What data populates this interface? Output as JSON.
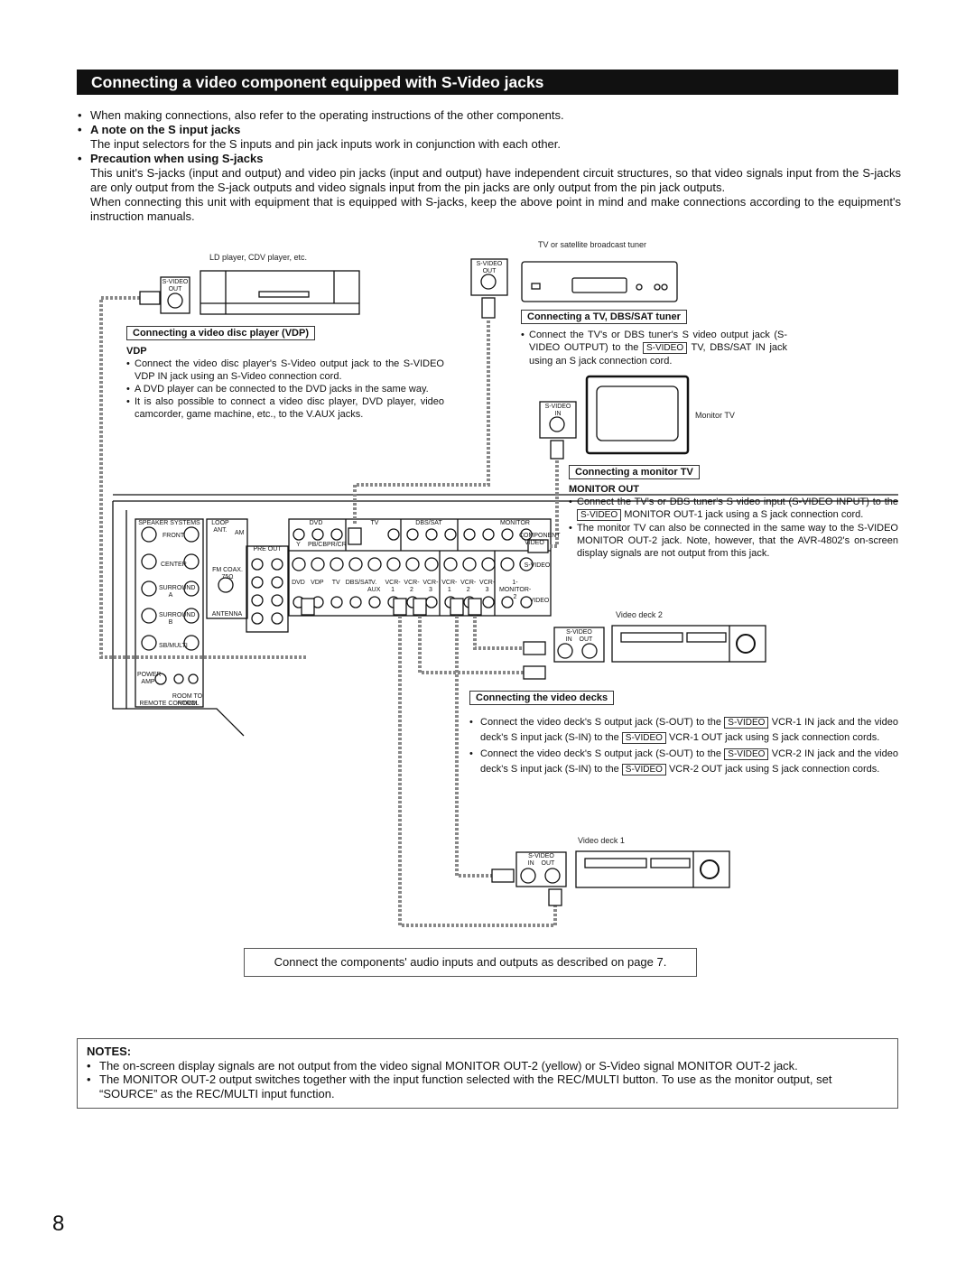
{
  "title": "Connecting a video component equipped with S-Video jacks",
  "intro": {
    "bullet1": "When making connections, also refer to the operating instructions of the other components.",
    "note_heading": "A note on the S input jacks",
    "note_text": "The input selectors for the S inputs and pin jack inputs work in conjunction with each other.",
    "precaution_heading": "Precaution when using S-jacks",
    "precaution_text1": "This unit's S-jacks (input and output) and video pin jacks (input and output) have independent circuit structures, so that video signals input from the S-jacks are only output from the S-jack outputs and video signals input from the pin jacks are only output from the pin jack outputs.",
    "precaution_text2": "When connecting this unit with equipment that is equipped with S-jacks, keep the above point in mind and make connections according to the equipment's instruction manuals."
  },
  "diagram": {
    "ld_label": "LD player, CDV player, etc.",
    "tuner_label": "TV or satellite broadcast tuner",
    "monitor_label": "Monitor TV",
    "deck2_label": "Video deck 2",
    "deck1_label": "Video deck 1",
    "svideo": "S-VIDEO",
    "out": "OUT",
    "in": "IN",
    "receiver": {
      "speaker_systems": "SPEAKER SYSTEMS",
      "front": "FRONT",
      "center": "CENTER",
      "surround_a": "SURROUND A",
      "surround_b": "SURROUND B",
      "sb_multi": "SB/MULTI",
      "loop_ant": "LOOP ANT.",
      "am": "AM",
      "fm_coax": "FM COAX. 75Ω",
      "antenna": "ANTENNA",
      "pre_out": "PRE OUT",
      "power_amp": "POWER AMP",
      "room_to_room": "ROOM TO ROOM",
      "remote_control": "REMOTE CONTROL",
      "component_groups": [
        "DVD",
        "TV",
        "DBS/SAT",
        "MONITOR"
      ],
      "component_jacks": [
        "Y",
        "PB/CB",
        "PR/CR"
      ],
      "component_video": "COMPONENT VIDEO",
      "s_video_in": [
        "DVD",
        "VDP",
        "TV",
        "DBS/SAT",
        "V. AUX",
        "VCR-1",
        "VCR-2",
        "VCR-3"
      ],
      "s_video_out": [
        "VCR-1",
        "VCR-2",
        "VCR-3"
      ],
      "monitor_out": "1-MONITOR-2",
      "s_video_lbl": "S-VIDEO",
      "video_lbl": "VIDEO"
    }
  },
  "vdp": {
    "tag": "Connecting a video disc player (VDP)",
    "heading": "VDP",
    "bullets": [
      "Connect the video disc player's S-Video output jack to the S-VIDEO VDP IN jack using an S-Video connection cord.",
      "A DVD player can be connected to the DVD jacks in the same way.",
      "It is also possible to connect a video disc player, DVD player, video camcorder, game machine, etc., to the V.AUX jacks."
    ]
  },
  "tuner": {
    "tag": "Connecting a TV, DBS/SAT tuner",
    "b1_pre": "Connect the TV's or DBS tuner's S video output jack (S-VIDEO OUTPUT) to the",
    "b1_post": "TV, DBS/SAT IN jack using an S jack connection cord."
  },
  "monitor": {
    "tag": "Connecting a monitor TV",
    "heading": "MONITOR OUT",
    "b1_pre": "Connect the TV's or DBS tuner's S video input (S-VIDEO INPUT) to the",
    "b1_post": "MONITOR OUT-1 jack using a S jack connection cord.",
    "b2": "The monitor TV can also be connected in the same way to the S-VIDEO MONITOR OUT-2 jack. Note, however, that the AVR-4802's on-screen display signals are not output from this jack."
  },
  "decks": {
    "tag": "Connecting the video decks",
    "b1_a": "Connect the video deck's S output jack (S-OUT) to the",
    "b1_b": "VCR-1 IN jack and the video deck's S input jack (S-IN) to the",
    "b1_c": "VCR-1 OUT jack using S jack connection cords.",
    "b2_a": "Connect the video deck's S output jack (S-OUT) to the",
    "b2_b": "VCR-2 IN jack and the video deck's S input jack (S-IN) to the",
    "b2_c": "VCR-2 OUT jack using S jack connection cords."
  },
  "caption": "Connect the components' audio inputs and outputs as described on page 7.",
  "notes": {
    "heading": "NOTES:",
    "items": [
      "The on-screen display signals are not output from the video signal MONITOR OUT-2 (yellow) or S-Video signal MONITOR OUT-2 jack.",
      "The MONITOR OUT-2 output switches together with the input function selected with the REC/MULTI button. To use as the monitor output, set “SOURCE” as the REC/MULTI input function."
    ]
  },
  "page_number": "8"
}
